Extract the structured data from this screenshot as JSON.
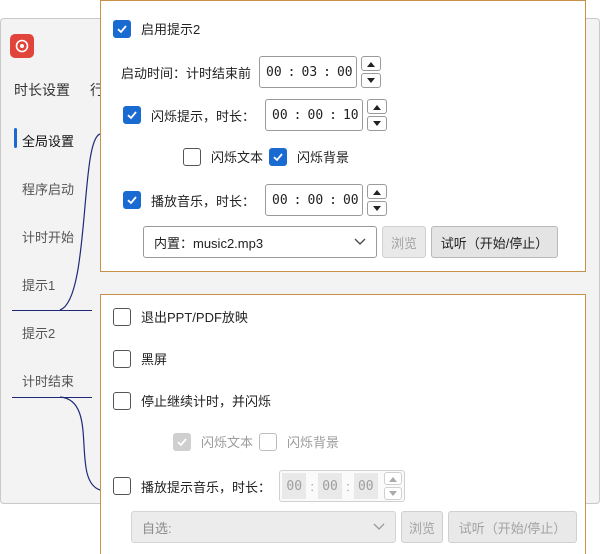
{
  "background": {
    "tabs": [
      "时长设置",
      "行"
    ],
    "sidebar": [
      "全局设置",
      "程序启动",
      "计时开始",
      "提示1",
      "提示2",
      "计时结束"
    ]
  },
  "top_panel": {
    "enable_prompt2": {
      "label": "启用提示2",
      "checked": true
    },
    "start_time": {
      "label": "启动时间：计时结束前",
      "h": "00",
      "m": "03",
      "s": "00"
    },
    "flash": {
      "label": "闪烁提示，时长：",
      "checked": true,
      "h": "00",
      "m": "00",
      "s": "10"
    },
    "flash_text": {
      "label": "闪烁文本",
      "checked": false
    },
    "flash_bg": {
      "label": "闪烁背景",
      "checked": true
    },
    "music": {
      "label": "播放音乐，时长：",
      "checked": true,
      "h": "00",
      "m": "00",
      "s": "00"
    },
    "music_select": "内置：music2.mp3",
    "browse": "浏览",
    "preview": "试听（开始/停止）"
  },
  "bottom_panel": {
    "exit_ppt": {
      "label": "退出PPT/PDF放映",
      "checked": false
    },
    "black_screen": {
      "label": "黑屏",
      "checked": false
    },
    "stop_continue": {
      "label": "停止继续计时，并闪烁",
      "checked": false
    },
    "flash_text": {
      "label": "闪烁文本",
      "checked": true
    },
    "flash_bg": {
      "label": "闪烁背景",
      "checked": false
    },
    "music": {
      "label": "播放提示音乐，时长：",
      "checked": false,
      "h": "00",
      "m": "00",
      "s": "00"
    },
    "music_select": "自选:",
    "browse": "浏览",
    "preview": "试听（开始/停止）"
  },
  "colors": {
    "accent": "#1a6bd1",
    "panel_border": "#c8914a",
    "connector": "#1e2a78"
  }
}
